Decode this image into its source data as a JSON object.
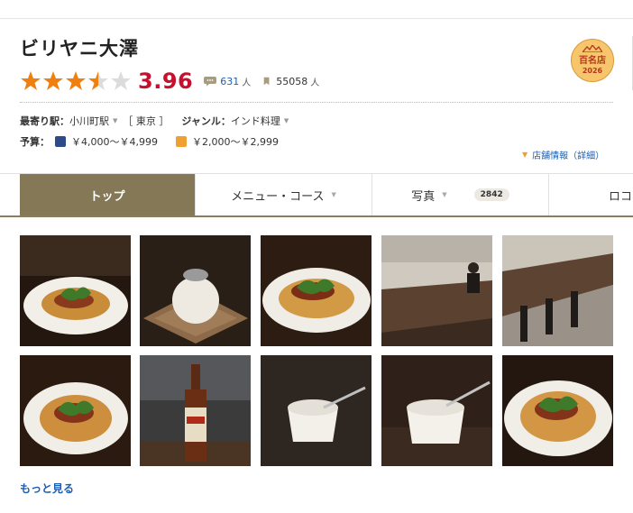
{
  "restaurant": {
    "name": "ビリヤニ大澤",
    "score": "3.96",
    "rating_value": 3.5,
    "rating_max": 5,
    "reviews_count": "631",
    "reviews_unit": "人",
    "saved_count": "55058",
    "saved_unit": "人"
  },
  "badge": {
    "name": "百名店",
    "year": "2026"
  },
  "info": {
    "station_label": "最寄り駅：",
    "station": "小川町駅",
    "area": "［ 東京 ］",
    "genre_label": "ジャンル：",
    "genre": "インド料理",
    "budget_label": "予算：",
    "dinner_budget": "￥4,000～￥4,999",
    "lunch_budget": "￥2,000～￥2,999"
  },
  "detail_link": "店舗情報（詳細）",
  "tabs": [
    {
      "label": "トップ"
    },
    {
      "label": "メニュー・コース"
    },
    {
      "label": "写真",
      "count": "2842"
    },
    {
      "label": "ロコ"
    }
  ],
  "photos": [
    "biryani-plate-1",
    "raita-ball",
    "biryani-plate-2",
    "counter-with-chef",
    "counter-bar",
    "biryani-plate-3",
    "ginger-beer-bottle",
    "raita-cup-1",
    "raita-cup-2",
    "biryani-plate-4"
  ],
  "more_link": "もっと見る",
  "colors": {
    "accent_red": "#c8102e",
    "star": "#f07f0f",
    "tab_active": "#847856",
    "link": "#1a5fb4"
  }
}
